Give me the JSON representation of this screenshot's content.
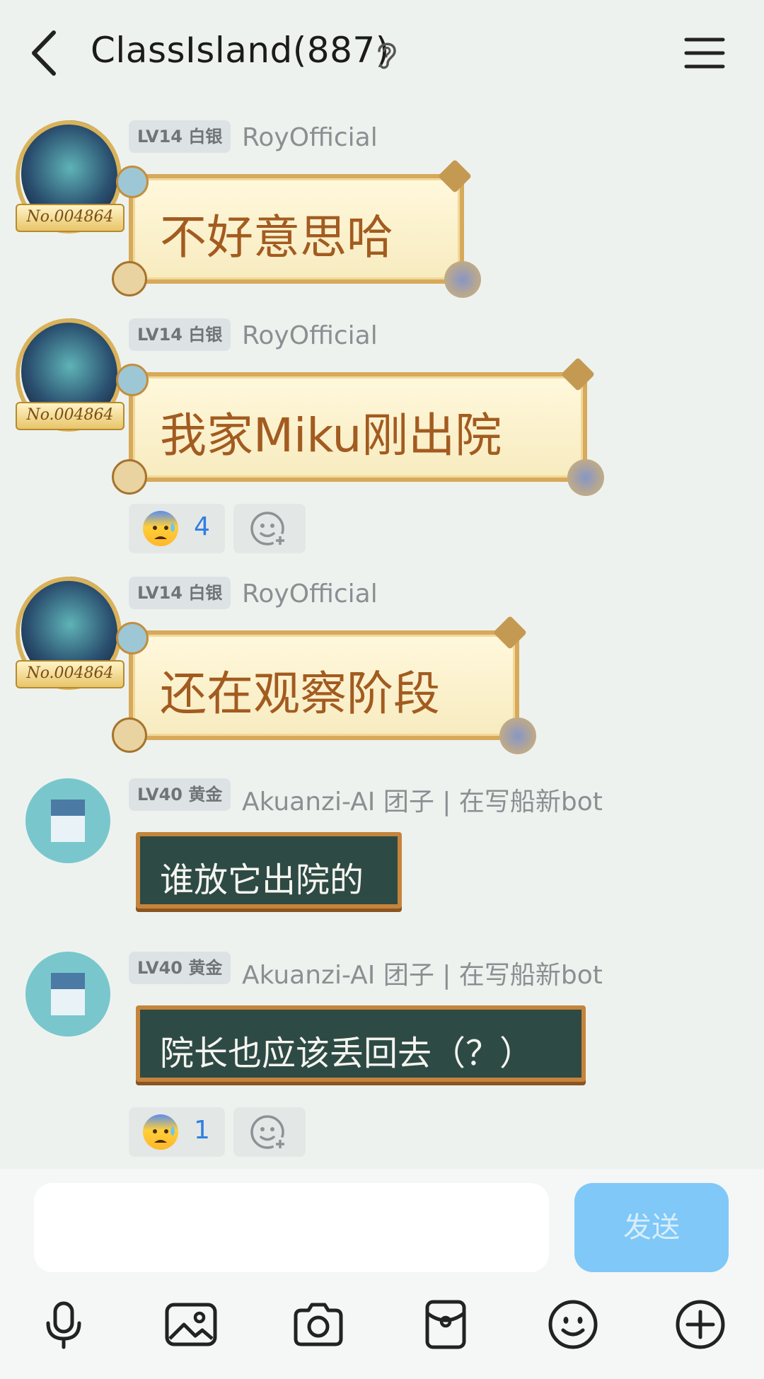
{
  "header": {
    "title": "ClassIsland(887)"
  },
  "messages": [
    {
      "level": "LV14 白银",
      "name": "RoyOfficial",
      "text": "不好意思哈",
      "avatar_badge": "No.004864"
    },
    {
      "level": "LV14 白银",
      "name": "RoyOfficial",
      "text": "我家Miku刚出院",
      "avatar_badge": "No.004864",
      "reaction": {
        "emoji": "anxious-sweat-face",
        "count": "4"
      }
    },
    {
      "level": "LV14 白银",
      "name": "RoyOfficial",
      "text": "还在观察阶段",
      "avatar_badge": "No.004864"
    },
    {
      "level": "LV40 黄金",
      "name": "Akuanzi-AI 团子 | 在写船新bot",
      "text": "谁放它出院的"
    },
    {
      "level": "LV40 黄金",
      "name": "Akuanzi-AI 团子 | 在写船新bot",
      "text": "院长也应该丢回去（？）",
      "reaction": {
        "emoji": "anxious-sweat-face",
        "count": "1"
      }
    }
  ],
  "composer": {
    "input_value": "",
    "send_label": "发送"
  },
  "toolbar": [
    "microphone-icon",
    "image-icon",
    "camera-icon",
    "red-packet-icon",
    "emoji-icon",
    "plus-icon"
  ],
  "colors": {
    "background": "#eef2ef",
    "send_button": "#7fc8f8",
    "reaction_count": "#2f7fe0",
    "parchment_text": "#a25b20",
    "board_bg": "#2e4a44"
  }
}
